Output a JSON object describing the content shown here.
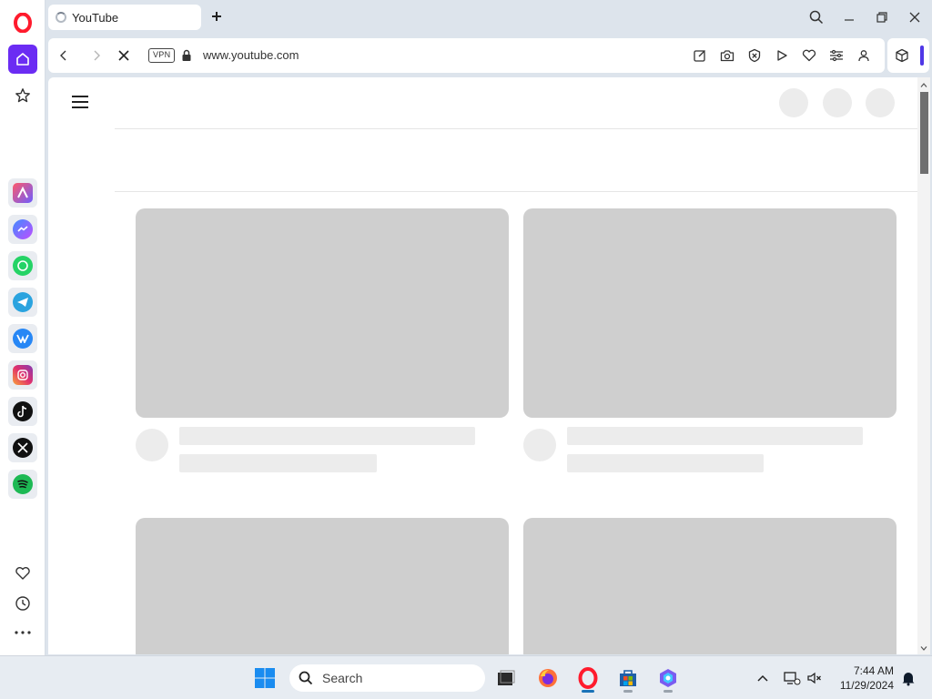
{
  "browser": {
    "tab": {
      "title": "YouTube"
    },
    "address": {
      "vpn_badge": "VPN",
      "url": "www.youtube.com"
    }
  },
  "sidebar": {
    "apps": [
      "aria-icon",
      "messenger-icon",
      "whatsapp-icon",
      "telegram-icon",
      "vk-icon",
      "instagram-icon",
      "tiktok-icon",
      "x-icon",
      "spotify-icon"
    ],
    "accent_color": "#6b2cf3"
  },
  "page": {
    "state": "loading-skeleton",
    "skeleton_color": "#cfcfcf"
  },
  "taskbar": {
    "search_label": "Search",
    "time": "7:44 AM",
    "date": "11/29/2024"
  }
}
